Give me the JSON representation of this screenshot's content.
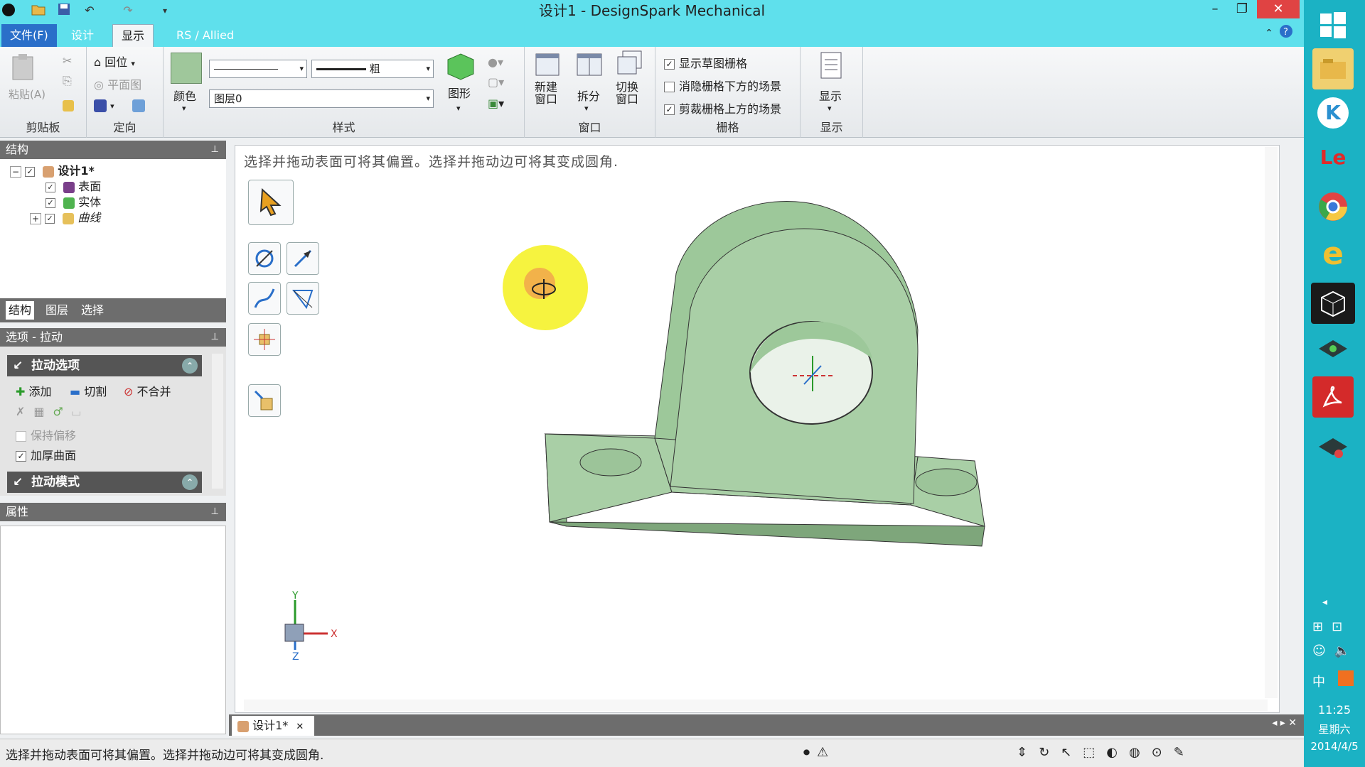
{
  "window": {
    "title": "设计1 - DesignSpark Mechanical",
    "minimize": "–",
    "restore": "❐",
    "close": "✕"
  },
  "ribbon_tabs": {
    "file": "文件(F)",
    "design": "设计",
    "display": "显示",
    "rs": "RS / Allied"
  },
  "ribbon": {
    "clipboard": {
      "label": "剪贴板",
      "paste": "粘贴(A)"
    },
    "orient": {
      "label": "定向",
      "home": "回位",
      "plan": "平面图"
    },
    "style": {
      "label": "样式",
      "color": "颜色",
      "line_weight": "粗",
      "layer": "图层0",
      "shape": "图形"
    },
    "window": {
      "label": "窗口",
      "new_window": "新建\n窗口",
      "split": "拆分",
      "switch": "切换\n窗口"
    },
    "grid": {
      "label": "栅格",
      "show_sketch_grid": "显示草图栅格",
      "hide_below": "消隐栅格下方的场景",
      "clip_above": "剪裁栅格上方的场景"
    },
    "display": {
      "label": "显示",
      "show": "显示"
    }
  },
  "structure": {
    "header": "结构",
    "root": "设计1*",
    "items": [
      "表面",
      "实体",
      "曲线"
    ],
    "tabs": [
      "结构",
      "图层",
      "选择"
    ]
  },
  "options": {
    "header": "选项 - 拉动",
    "pull_options": "拉动选项",
    "add": "添加",
    "cut": "切割",
    "no_merge": "不合并",
    "keep_offset": "保持偏移",
    "thicken_surface": "加厚曲面",
    "pull_mode": "拉动模式"
  },
  "properties": {
    "header": "属性"
  },
  "viewport": {
    "hint": "选择并拖动表面可将其偏置。选择并拖动边可将其变成圆角.",
    "axes": {
      "x": "X",
      "y": "Y",
      "z": "Z"
    }
  },
  "doc_tab": {
    "label": "设计1*",
    "close": "✕"
  },
  "status": {
    "text": "选择并拖动表面可将其偏置。选择并拖动边可将其变成圆角."
  },
  "clock": {
    "time": "11:25",
    "day": "星期六",
    "date": "2014/4/5"
  },
  "taskbar_text": {
    "ime": "中",
    "k": "K",
    "le": "Le"
  },
  "colors": {
    "accent": "#5fe0ec",
    "part": "#a9cfa6",
    "taskbar": "#1bb2c4"
  }
}
